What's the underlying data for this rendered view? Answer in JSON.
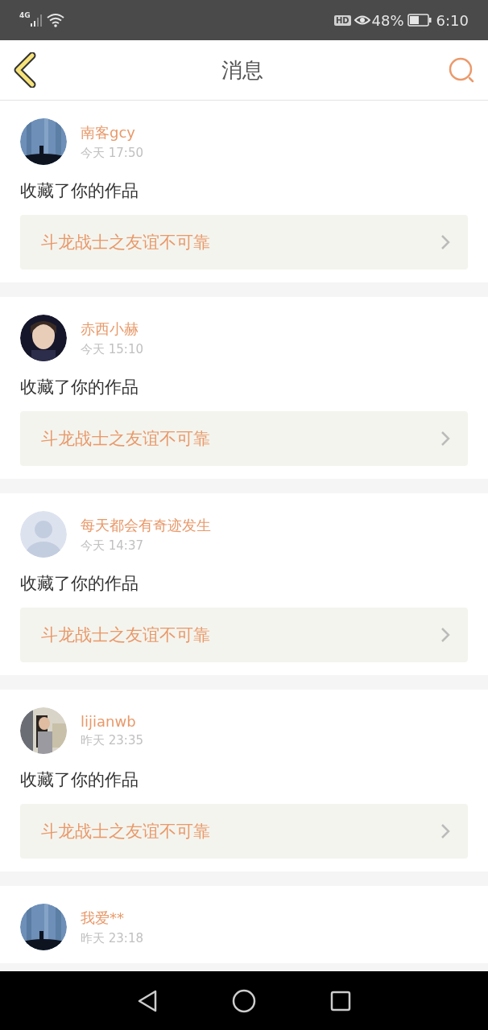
{
  "status_bar": {
    "network": "4G",
    "hd": "HD",
    "battery": "48%",
    "time": "6:10"
  },
  "header": {
    "title": "消息"
  },
  "messages": [
    {
      "name": "南客gcy",
      "time": "今天 17:50",
      "text": "收藏了你的作品",
      "work": "斗龙战士之友谊不可靠"
    },
    {
      "name": "赤西小赫",
      "time": "今天 15:10",
      "text": "收藏了你的作品",
      "work": "斗龙战士之友谊不可靠"
    },
    {
      "avatar": {
        "kind": "default"
      },
      "name": "每天都会有奇迹发生",
      "time": "今天 14:37",
      "text": "收藏了你的作品",
      "work": "斗龙战士之友谊不可靠"
    },
    {
      "name": "lijianwb",
      "time": "昨天 23:35",
      "text": "收藏了你的作品",
      "work": "斗龙战士之友谊不可靠"
    },
    {
      "name": "我爱**",
      "time": "昨天 23:18"
    }
  ]
}
